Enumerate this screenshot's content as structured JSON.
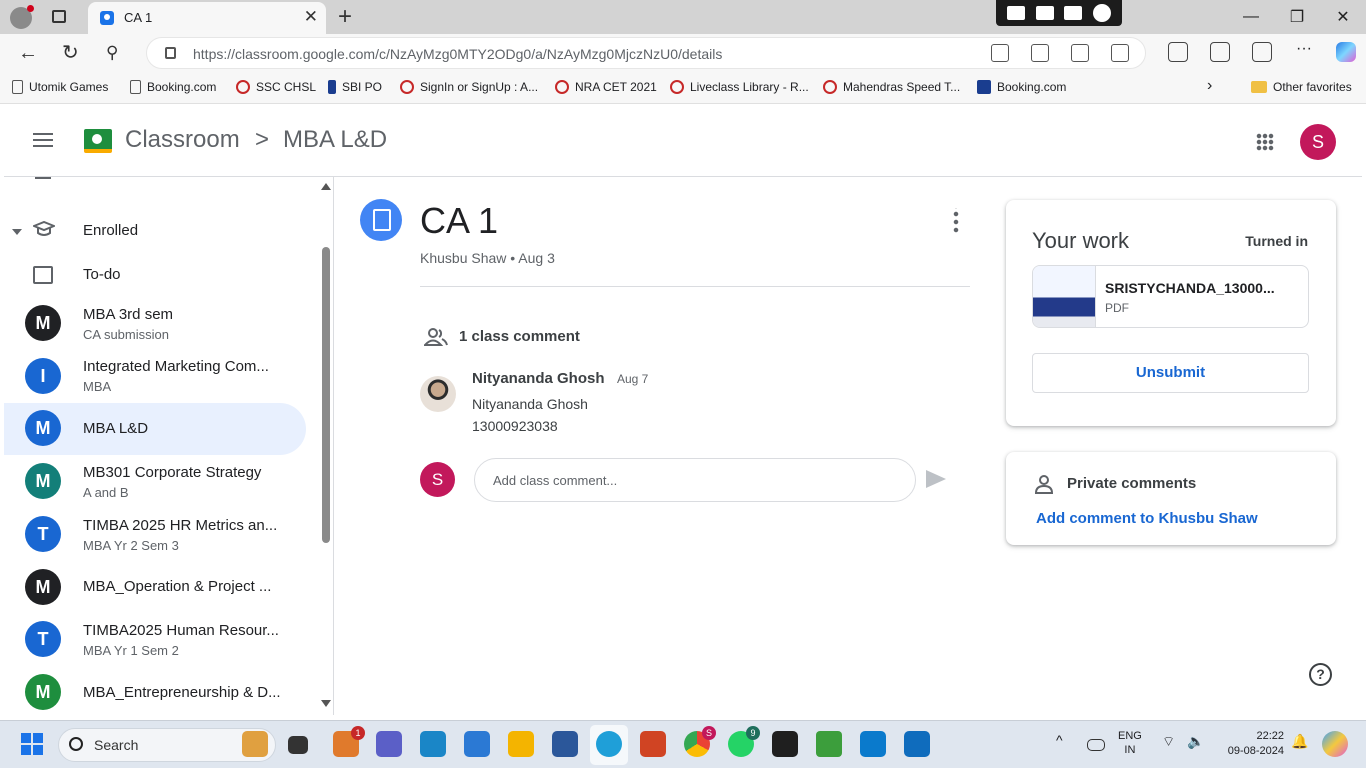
{
  "browser": {
    "tab_title": "CA 1",
    "url": "https://classroom.google.com/c/NzAyMzg0MTY2ODg0/a/NzAyMzg0MjczNzU0/details",
    "bookmarks": [
      "Utomik Games",
      "Booking.com",
      "SSC CHSL",
      "SBI PO",
      "SignIn or SignUp : A...",
      "NRA CET 2021",
      "Liveclass Library - R...",
      "Mahendras Speed T...",
      "Booking.com"
    ],
    "other_favorites": "Other favorites"
  },
  "header": {
    "app_name": "Classroom",
    "separator": ">",
    "class_name": "MBA L&D",
    "user_initial": "S"
  },
  "sidebar": {
    "enrolled_label": "Enrolled",
    "todo_label": "To-do",
    "classes": [
      {
        "initial": "M",
        "name": "MBA 3rd sem",
        "sub": "CA submission",
        "color": "#202124"
      },
      {
        "initial": "I",
        "name": "Integrated Marketing Com...",
        "sub": "MBA",
        "color": "#1967d2"
      },
      {
        "initial": "M",
        "name": "MBA L&D",
        "sub": "",
        "color": "#1967d2"
      },
      {
        "initial": "M",
        "name": "MB301 Corporate Strategy",
        "sub": "A and B",
        "color": "#137f79"
      },
      {
        "initial": "T",
        "name": "TIMBA 2025 HR Metrics an...",
        "sub": "MBA Yr 2 Sem 3",
        "color": "#1967d2"
      },
      {
        "initial": "M",
        "name": "MBA_Operation & Project ...",
        "sub": "",
        "color": "#202124"
      },
      {
        "initial": "T",
        "name": "TIMBA2025 Human Resour...",
        "sub": "MBA Yr 1 Sem 2",
        "color": "#1967d2"
      },
      {
        "initial": "M",
        "name": "MBA_Entrepreneurship & D...",
        "sub": "",
        "color": "#1e8e3e"
      }
    ]
  },
  "assignment": {
    "title": "CA 1",
    "meta": "Khusbu Shaw • Aug 3",
    "comment_count_label": "1 class comment",
    "comment": {
      "author": "Nityananda Ghosh",
      "date": "Aug 7",
      "lines": [
        "Nityananda Ghosh",
        "13000923038"
      ]
    },
    "comment_placeholder": "Add class comment...",
    "user_initial": "S"
  },
  "your_work": {
    "title": "Your work",
    "status": "Turned in",
    "attachment_name": "SRISTYCHANDA_13000...",
    "attachment_type": "PDF",
    "unsubmit_label": "Unsubmit"
  },
  "private_comments": {
    "title": "Private comments",
    "link": "Add comment to Khusbu Shaw"
  },
  "taskbar": {
    "search_label": "Search",
    "lang_line1": "ENG",
    "lang_line2": "IN",
    "time": "22:22",
    "date": "09-08-2024",
    "badges": {
      "mail": "1",
      "chrome": "S",
      "whatsapp": "9"
    }
  },
  "colors": {
    "accent": "#1967d2",
    "avatar_pink": "#c2185b",
    "active_row": "#e8f0fe"
  }
}
